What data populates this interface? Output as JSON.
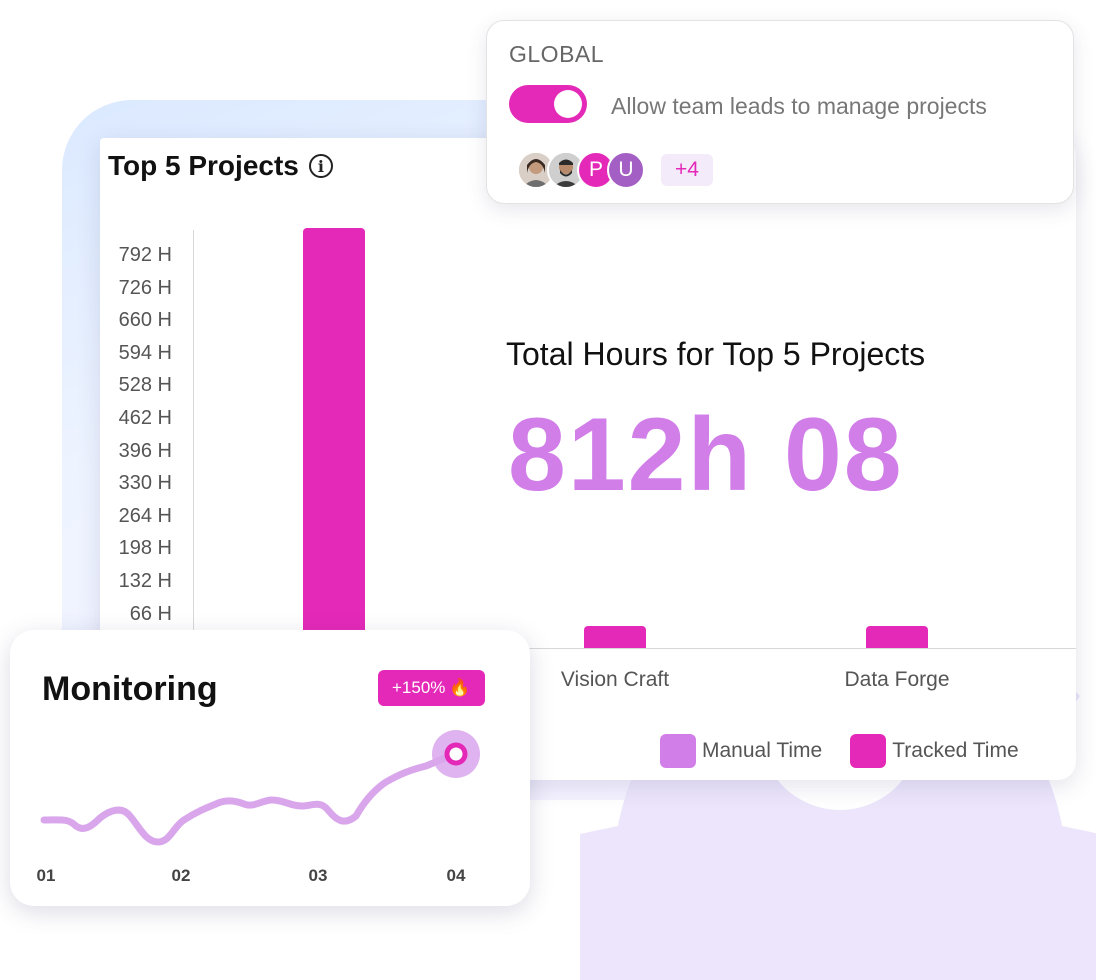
{
  "projects_chart": {
    "title": "Top 5 Projects",
    "total_label": "Total Hours for Top 5 Projects",
    "total_value": "812h 08",
    "chart_data": {
      "type": "bar",
      "categories": [
        "",
        "Vision Craft",
        "Data Forge"
      ],
      "series": [
        {
          "name": "Tracked Time",
          "values": [
            792,
            10,
            10
          ]
        },
        {
          "name": "Manual Time",
          "values": [
            0,
            0,
            0
          ]
        }
      ],
      "yticks": [
        "792 H",
        "726 H",
        "660 H",
        "594 H",
        "528 H",
        "462 H",
        "396 H",
        "330 H",
        "264 H",
        "198 H",
        "132 H",
        "66 H"
      ],
      "ylim": [
        0,
        792
      ],
      "legend": [
        "Manual Time",
        "Tracked Time"
      ],
      "legend_position": "bottom-right"
    },
    "colors": {
      "tracked": "#e429b8",
      "manual": "#d17ee8"
    }
  },
  "global_settings": {
    "title": "GLOBAL",
    "toggle_label": "Allow team leads to manage projects",
    "toggle_on": true,
    "avatars": [
      {
        "type": "photo",
        "name": "avatar-photo-1"
      },
      {
        "type": "photo",
        "name": "avatar-photo-2"
      },
      {
        "type": "initial",
        "initial": "P",
        "color": "#e429b8"
      },
      {
        "type": "initial",
        "initial": "U",
        "color": "#a45fc4"
      }
    ],
    "more_count": "+4"
  },
  "monitoring": {
    "title": "Monitoring",
    "badge": "+150%",
    "badge_icon": "fire-icon",
    "xticks": [
      "01",
      "02",
      "03",
      "04"
    ],
    "line_color": "#d9a6ec",
    "marker_color": "#e429b8"
  }
}
